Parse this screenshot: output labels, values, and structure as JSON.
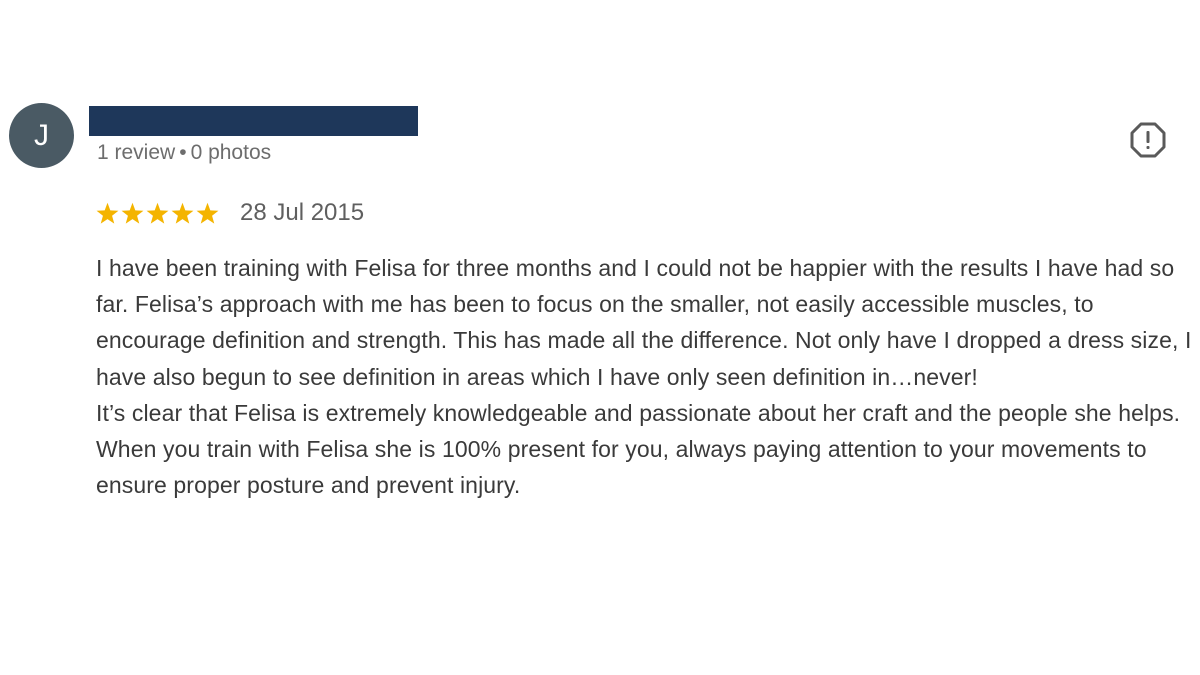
{
  "reviewer": {
    "avatar_initial": "J",
    "avatar_color": "#4a5a64",
    "name_redaction_color": "#1e375a",
    "review_count": "1 review",
    "separator": "•",
    "photo_count": "0 photos"
  },
  "report_icon": "report-icon",
  "rating": {
    "stars": 5,
    "max_stars": 5,
    "star_color": "#f4b400",
    "date": "28 Jul 2015"
  },
  "review": {
    "paragraph_1": "I have been training with Felisa for three months and I could not be happier with the results I have had so far. Felisa’s approach with me has been to focus on the smaller, not easily accessible muscles, to encourage definition and strength. This has made all the difference. Not only have I dropped a dress size, I have also begun to see definition in areas which I have only seen definition in…never!",
    "paragraph_2": "It’s clear that Felisa is extremely knowledgeable and passionate about her craft and the people she helps. When you train with Felisa she is 100% present for you, always paying attention to your movements to ensure proper posture and prevent injury."
  }
}
